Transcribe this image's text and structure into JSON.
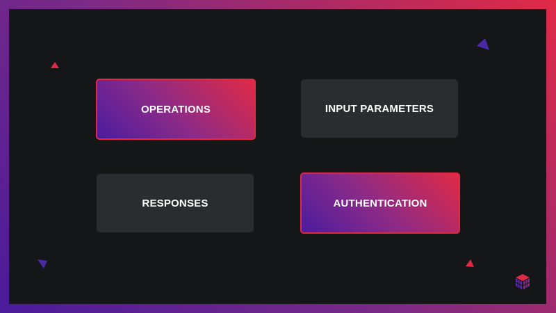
{
  "cards": [
    {
      "label": "OPERATIONS",
      "state": "active"
    },
    {
      "label": "INPUT PARAMETERS",
      "state": "inactive"
    },
    {
      "label": "RESPONSES",
      "state": "inactive"
    },
    {
      "label": "AUTHENTICATION",
      "state": "active"
    }
  ],
  "colors": {
    "background": "#151618",
    "card_inactive": "#2b2c2f",
    "accent_red": "#e02a45",
    "accent_purple": "#4a1c9e",
    "text": "#ffffff"
  },
  "icons": {
    "brand_logo": "cube-logo-icon",
    "decor": "triangle-icon"
  }
}
